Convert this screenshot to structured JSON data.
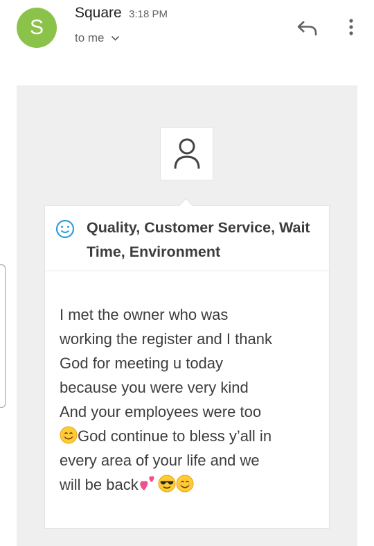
{
  "header": {
    "avatar_letter": "S",
    "sender_name": "Square",
    "time": "3:18 PM",
    "recipient": "to me",
    "avatar_color": "#8BC34A"
  },
  "icons": {
    "reply": "reply-icon",
    "more": "more-vert-icon",
    "expand": "chevron-down-icon",
    "person": "person-icon",
    "smiley": "smiley-icon"
  },
  "review": {
    "title": "Quality, Customer Service, Wait Time, Environment",
    "lines": [
      "I met the owner who was",
      "working the register and I thank",
      "God for meeting u today",
      "because you were very kind",
      "And your employees were too",
      "God continue to bless y’all in",
      "every area of your life and we",
      "will be back"
    ]
  }
}
